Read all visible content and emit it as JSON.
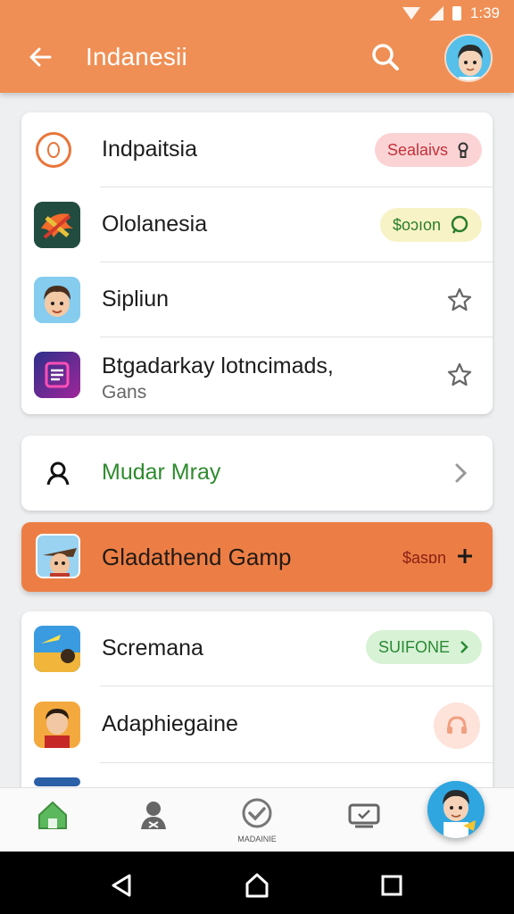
{
  "status_bar": {
    "time": "1:39"
  },
  "appbar": {
    "title": "Indanesii"
  },
  "list1": [
    {
      "title": "Indpaitsia",
      "badge": "Sealaivs",
      "badge_icon": "keyhole-icon"
    },
    {
      "title": "Ololanesia",
      "badge": "$oɔıon",
      "badge_icon": "chat-icon"
    },
    {
      "title": "Sipliun",
      "action_icon": "star-icon"
    },
    {
      "title": "Btgadarkay lotncimads,",
      "subtitle": "Gans",
      "action_icon": "star-icon"
    }
  ],
  "mudar_row": {
    "title": "Mudar Mray"
  },
  "featured": {
    "title": "Gladathend Gamp",
    "price": "$asɒn"
  },
  "list2": [
    {
      "title": "Scremana",
      "badge": "SUIFONE"
    },
    {
      "title": "Adaphiegaine"
    }
  ],
  "bottom_nav": {
    "items": [
      {
        "icon": "home-icon"
      },
      {
        "icon": "profile-icon"
      },
      {
        "icon": "check-badge-icon",
        "label": "MADAINIE"
      },
      {
        "icon": "tv-icon"
      }
    ]
  },
  "colors": {
    "accent": "#ef8f55",
    "featured": "#ec7e45",
    "green": "#2e8b2e"
  }
}
